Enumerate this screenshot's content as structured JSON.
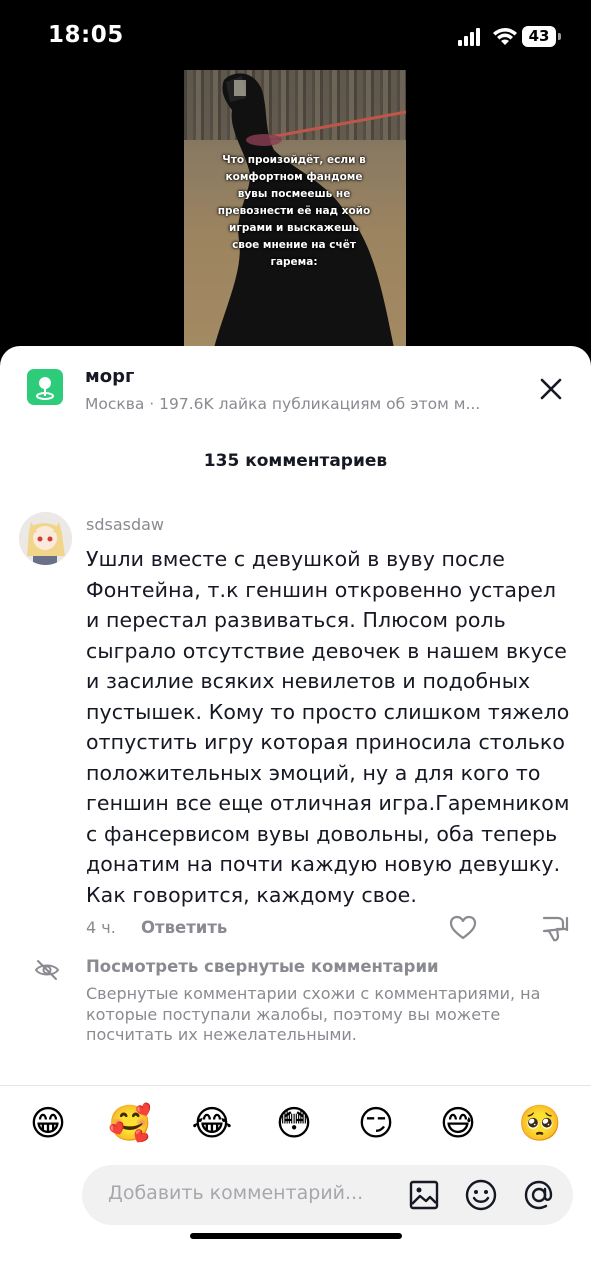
{
  "status_bar": {
    "time": "18:05",
    "battery": "43"
  },
  "video": {
    "overlay_text": "Что произойдёт, если в комфортном фандоме вувы посмеешь не превознести её над хойо играми и выскажешь свое мнение на счёт гарема:"
  },
  "sheet": {
    "location_name": "морг",
    "location_subtitle": "Москва · 197.6K лайка публикациям об этом м...",
    "comment_count": "135 комментариев"
  },
  "comment": {
    "username": "sdsasdaw",
    "text": "Ушли вместе с девушкой в вуву после Фонтейна, т.к геншин откровенно устарел и перестал развиваться. Плюсом роль сыграло отсутствие девочек в нашем вкусе и засилие всяких невилетов и подобных пустышек. Кому то просто слишком тяжело отпустить игру которая приносила столько положительных эмоций, ну а для кого то геншин все еще отличная игра.Гаремником с фансервисом вувы довольны, оба теперь донатим на почти каждую новую девушку. Как говорится, каждому свое.",
    "time": "4 ч.",
    "reply_label": "Ответить"
  },
  "hidden_comments": {
    "title": "Посмотреть свернутые комментарии",
    "description": "Свернутые комментарии схожи с комментариями, на которые поступали жалобы, поэтому вы можете посчитать их нежелательными."
  },
  "emoji_bar": [
    "😁",
    "🥰",
    "😂",
    "😳",
    "😏",
    "😅",
    "🥺"
  ],
  "comment_input": {
    "placeholder": "Добавить комментарий..."
  },
  "colors": {
    "accent_green": "#2ecc7a",
    "muted_text": "#8a8b91",
    "primary_text": "#161823"
  },
  "icons": [
    "map-pin-icon",
    "close-icon",
    "heart-icon",
    "dislike-icon",
    "eye-hidden-icon",
    "image-icon",
    "emoji-icon",
    "mention-icon"
  ]
}
